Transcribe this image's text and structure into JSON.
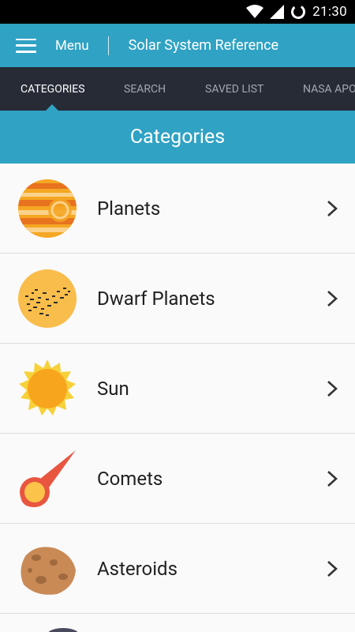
{
  "status_bar": {
    "time": "21:30"
  },
  "app_bar": {
    "menu_label": "Menu",
    "title": "Solar System Reference"
  },
  "tabs": [
    {
      "label": "CATEGORIES",
      "active": true
    },
    {
      "label": "SEARCH",
      "active": false
    },
    {
      "label": "SAVED LIST",
      "active": false
    },
    {
      "label": "NASA APOD",
      "active": false
    }
  ],
  "section": {
    "title": "Categories"
  },
  "categories": [
    {
      "label": "Planets",
      "icon": "planet-icon"
    },
    {
      "label": "Dwarf Planets",
      "icon": "dwarf-planet-icon"
    },
    {
      "label": "Sun",
      "icon": "sun-icon"
    },
    {
      "label": "Comets",
      "icon": "comet-icon"
    },
    {
      "label": "Asteroids",
      "icon": "asteroid-icon"
    }
  ],
  "colors": {
    "primary": "#30a2c4",
    "tab_bar": "#262b36",
    "background": "#fafafa"
  }
}
